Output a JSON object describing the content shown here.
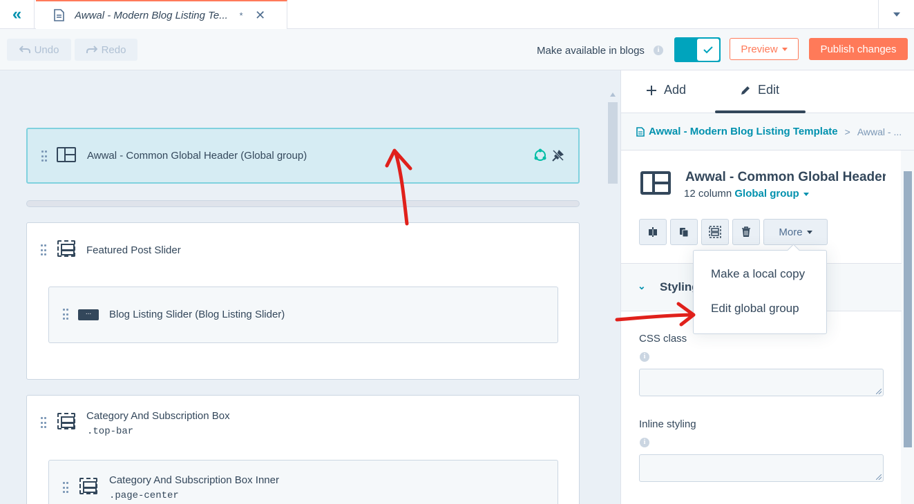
{
  "tab": {
    "title": "Awwal - Modern Blog Listing Te...",
    "unsaved_marker": "*",
    "close_glyph": "✕"
  },
  "toolbar": {
    "undo_label": "Undo",
    "redo_label": "Redo",
    "make_available_label": "Make available in blogs",
    "make_available_on": true,
    "preview_label": "Preview",
    "publish_label": "Publish changes"
  },
  "canvas": {
    "global_header": {
      "label": "Awwal - Common Global Header (Global group)"
    },
    "featured": {
      "label": "Featured Post Slider",
      "child_label": "Blog Listing Slider (Blog Listing Slider)",
      "child_icon_text": "..."
    },
    "category": {
      "label": "Category And Subscription Box",
      "class": ".top-bar",
      "inner_label": "Category And Subscription Box Inner",
      "inner_class": ".page-center"
    }
  },
  "sidebar": {
    "tabs": {
      "add": "Add",
      "edit": "Edit"
    },
    "breadcrumb": {
      "link": "Awwal - Modern Blog Listing Template",
      "separator": ">",
      "current": "Awwal - ..."
    },
    "module": {
      "title": "Awwal - Common Global Header",
      "columns": "12 column",
      "group_link": "Global group"
    },
    "more_label": "More",
    "styling_label": "Styling",
    "css_class_label": "CSS class",
    "inline_styling_label": "Inline styling"
  },
  "dropdown": {
    "items": [
      "Make a local copy",
      "Edit global group"
    ]
  },
  "colors": {
    "accent": "#ff7a59",
    "teal": "#0091ae",
    "toggle": "#00a4bd",
    "annotation": "#e0201b",
    "selected_bg": "#d6ecf3"
  },
  "icons": {
    "collapse": "double-chevron-left-icon",
    "document": "document-icon",
    "undo": "undo-icon",
    "redo": "redo-icon",
    "check": "check-icon",
    "plus": "plus-icon",
    "pencil": "pencil-icon",
    "sync": "sync-icon",
    "unpin": "unpin-icon",
    "clone": "clone-icon",
    "duplicate": "duplicate-icon",
    "wrap": "wrap-icon",
    "trash": "trash-icon"
  }
}
